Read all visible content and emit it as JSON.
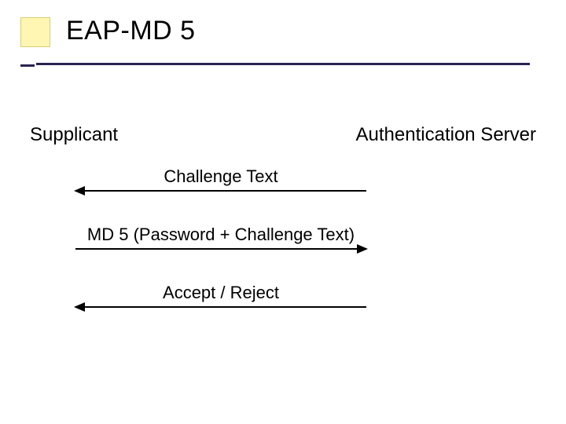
{
  "title": "EAP-MD 5",
  "actors": {
    "left": "Supplicant",
    "right": "Authentication Server"
  },
  "messages": {
    "m1": "Challenge Text",
    "m2": "MD 5 (Password + Challenge Text)",
    "m3": "Accept / Reject"
  },
  "colors": {
    "rule": "#2a2350",
    "square": "#fff6b3"
  }
}
